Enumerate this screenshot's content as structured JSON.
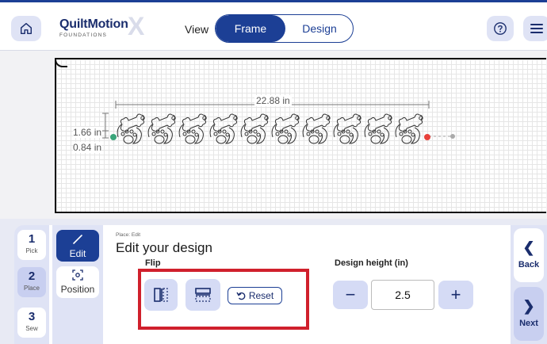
{
  "header": {
    "logo_main": "QuiltMotion",
    "logo_sub": "FOUNDATIONS",
    "logo_x": "X",
    "view_label": "View",
    "tabs": [
      {
        "label": "Frame",
        "active": true
      },
      {
        "label": "Design",
        "active": false
      }
    ]
  },
  "canvas": {
    "width_dim": "22.88 in",
    "height_dim_top": "1.66 in",
    "height_dim_bottom": "0.84 in",
    "pattern_repeats": 10,
    "start_marker_color": "#3aa57a",
    "end_marker_color": "#e8413b"
  },
  "steps": [
    {
      "num": "1",
      "label": "Pick",
      "active": false
    },
    {
      "num": "2",
      "label": "Place",
      "active": true
    },
    {
      "num": "3",
      "label": "Sew",
      "active": false
    }
  ],
  "subnav": {
    "edit_label": "Edit",
    "position_label": "Position"
  },
  "main": {
    "breadcrumb": "Place: Edit",
    "title": "Edit your design",
    "flip_label": "Flip",
    "reset_label": "Reset",
    "design_height_label": "Design height (in)",
    "design_height_value": "2.5"
  },
  "nav": {
    "back_label": "Back",
    "next_label": "Next"
  },
  "colors": {
    "brand": "#1c3f95",
    "highlight": "#d0202c"
  }
}
